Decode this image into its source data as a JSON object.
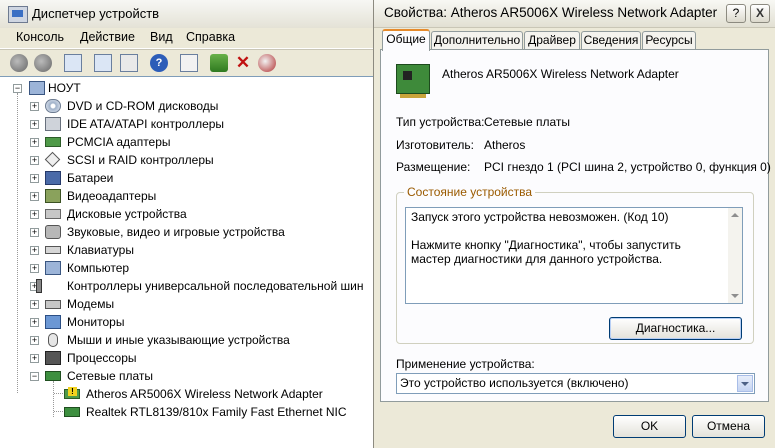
{
  "device_manager": {
    "title": "Диспетчер устройств",
    "menu": [
      "Консоль",
      "Действие",
      "Вид",
      "Справка"
    ],
    "toolbar_icons": [
      "back-icon",
      "forward-icon",
      "properties-icon",
      "print-icon",
      "help-icon",
      "scan-hardware-icon",
      "update-driver-icon",
      "uninstall-icon",
      "disable-icon"
    ],
    "tree": {
      "root": "НОУТ",
      "categories": [
        "DVD и CD-ROM дисководы",
        "IDE ATA/ATAPI контроллеры",
        "PCMCIA адаптеры",
        "SCSI и RAID контроллеры",
        "Батареи",
        "Видеоадаптеры",
        "Дисковые устройства",
        "Звуковые, видео и игровые устройства",
        "Клавиатуры",
        "Компьютер",
        "Контроллеры универсальной последовательной шин",
        "Модемы",
        "Мониторы",
        "Мыши и иные указывающие устройства",
        "Процессоры",
        "Сетевые платы"
      ],
      "network_children": [
        "Atheros AR5006X Wireless Network Adapter",
        "Realtek RTL8139/810x Family Fast Ethernet NIC"
      ]
    }
  },
  "properties": {
    "title": "Свойства: Atheros AR5006X Wireless Network Adapter",
    "help_glyph": "?",
    "close_glyph": "X",
    "tabs": [
      "Общие",
      "Дополнительно",
      "Драйвер",
      "Сведения",
      "Ресурсы"
    ],
    "device_name": "Atheros AR5006X Wireless Network Adapter",
    "fields": {
      "type_label": "Тип устройства:",
      "type_value": "Сетевые платы",
      "maker_label": "Изготовитель:",
      "maker_value": "Atheros",
      "location_label": "Размещение:",
      "location_value": "PCI гнездо 1 (PCI шина 2, устройство 0, функция 0)"
    },
    "status_group_title": "Состояние устройства",
    "status_line1": "Запуск этого устройства невозможен. (Код 10)",
    "status_line2": "Нажмите кнопку \"Диагностика\", чтобы запустить мастер диагностики для данного устройства.",
    "diagnostics_button": "Диагностика...",
    "usage_label": "Применение устройства:",
    "usage_value": "Это устройство используется (включено)",
    "ok_button": "OK",
    "cancel_button": "Отмена"
  }
}
